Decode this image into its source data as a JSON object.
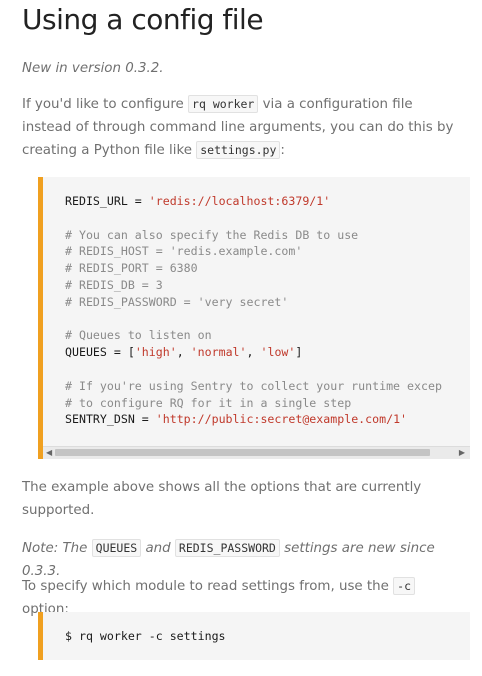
{
  "heading": "Using a config file",
  "version_note": "New in version 0.3.2.",
  "intro": {
    "part1": "If you'd like to configure ",
    "code1": "rq worker",
    "part2": " via a configuration file instead of through command line arguments, you can do this by creating a Python file like ",
    "code2": "settings.py",
    "part3": ":"
  },
  "config_code": {
    "l1_a": "REDIS_URL = ",
    "l1_s": "'redis://localhost:6379/1'",
    "l3": "# You can also specify the Redis DB to use",
    "l4": "# REDIS_HOST = 'redis.example.com'",
    "l5": "# REDIS_PORT = 6380",
    "l6": "# REDIS_DB = 3",
    "l7": "# REDIS_PASSWORD = 'very secret'",
    "l9": "# Queues to listen on",
    "l10_a": "QUEUES = [",
    "l10_s1": "'high'",
    "l10_sep1": ", ",
    "l10_s2": "'normal'",
    "l10_sep2": ", ",
    "l10_s3": "'low'",
    "l10_b": "]",
    "l12": "# If you're using Sentry to collect your runtime excep",
    "l13": "# to configure RQ for it in a single step",
    "l14_a": "SENTRY_DSN = ",
    "l14_s": "'http://public:secret@example.com/1'"
  },
  "scrollbar": {
    "left_arrow": "◀",
    "right_arrow": "▶"
  },
  "example_text": "The example above shows all the options that are currently supported.",
  "note": {
    "part1": "Note: The ",
    "code1": "QUEUES",
    "part2": " and ",
    "code2": "REDIS_PASSWORD",
    "part3": " settings are new since 0.3.3."
  },
  "module_text": {
    "part1": "To specify which module to read settings from, use the ",
    "code1": "-c",
    "part2": " option:"
  },
  "command_code": "$ rq worker -c settings"
}
